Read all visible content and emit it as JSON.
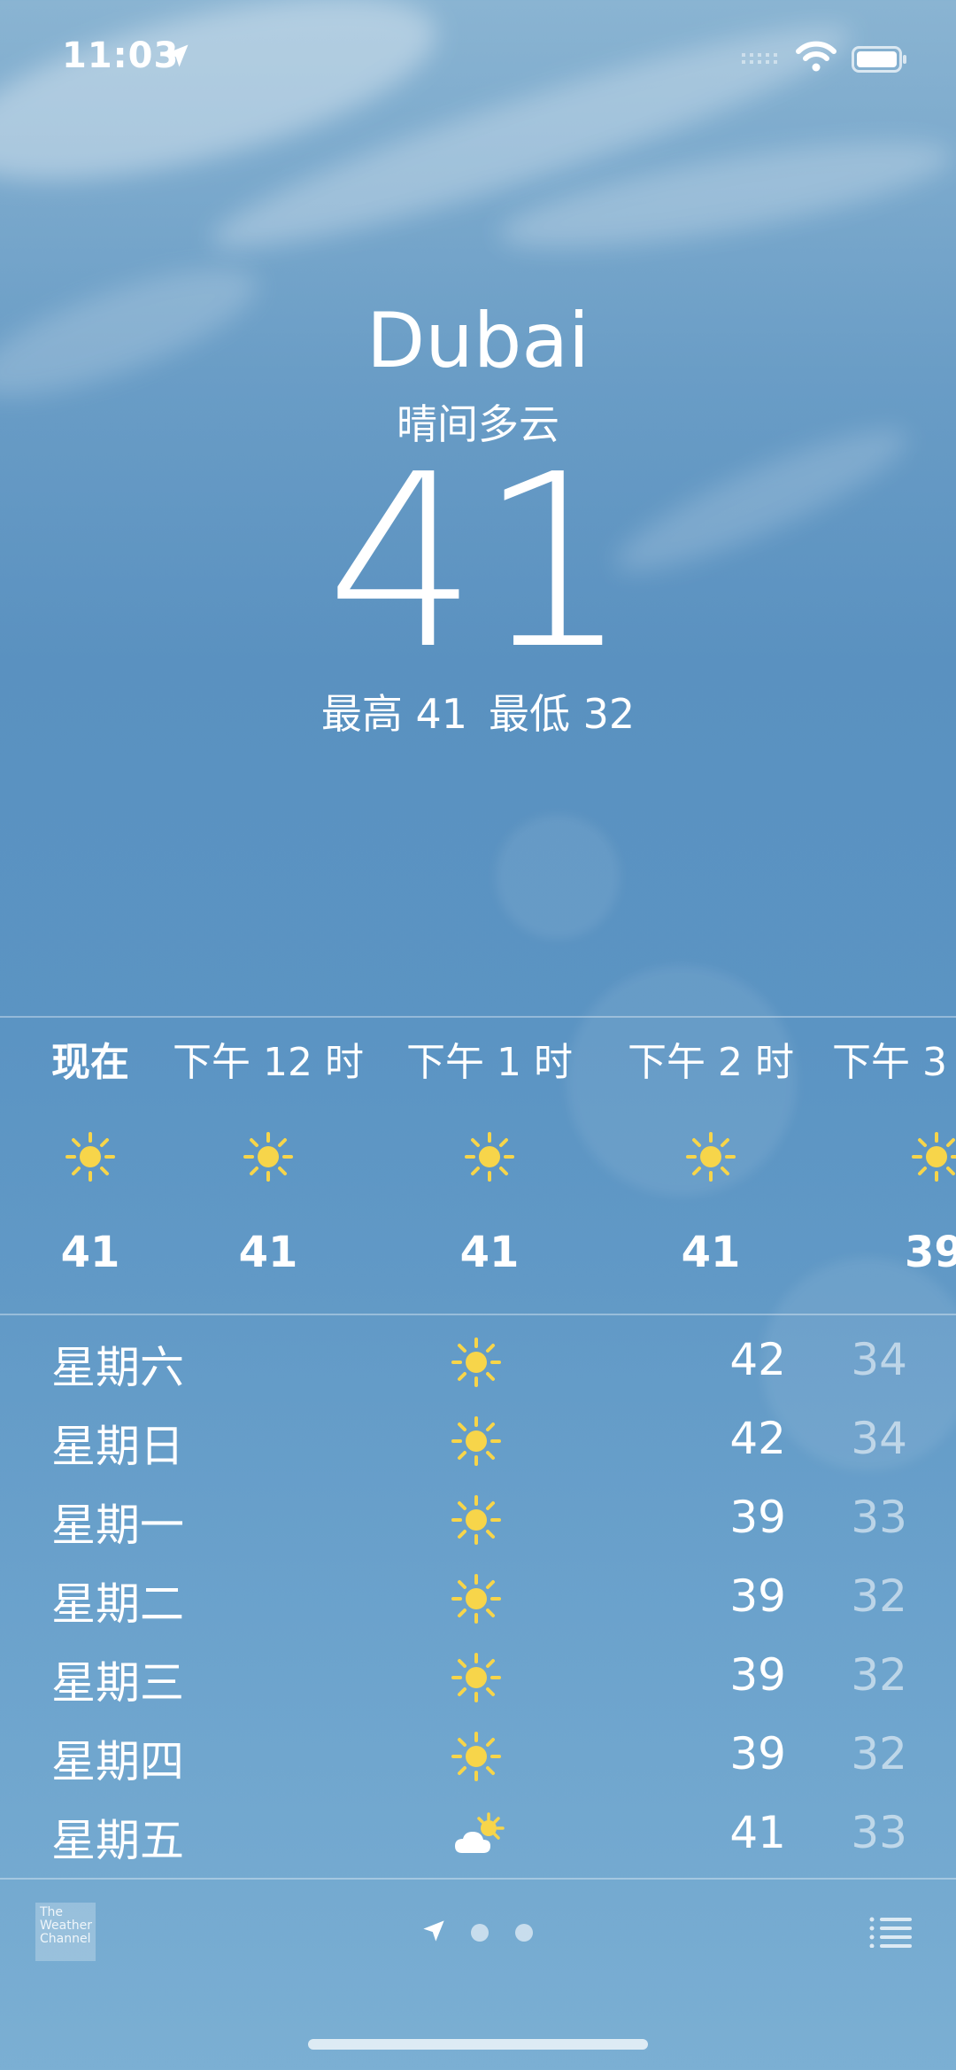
{
  "status_bar": {
    "time": "11:03"
  },
  "header": {
    "city": "Dubai",
    "condition": "晴间多云",
    "temperature": "41",
    "high_label": "最高 41",
    "low_label": "最低 32"
  },
  "hourly": [
    {
      "label": "现在",
      "icon": "sun-icon",
      "temp": "41"
    },
    {
      "label": "下午 12 时",
      "icon": "sun-icon",
      "temp": "41"
    },
    {
      "label": "下午 1 时",
      "icon": "sun-icon",
      "temp": "41"
    },
    {
      "label": "下午 2 时",
      "icon": "sun-icon",
      "temp": "41"
    },
    {
      "label": "下午 3",
      "icon": "sun-icon",
      "temp": "39"
    }
  ],
  "daily": [
    {
      "day": "星期六",
      "icon": "sun-icon",
      "high": "42",
      "low": "34"
    },
    {
      "day": "星期日",
      "icon": "sun-icon",
      "high": "42",
      "low": "34"
    },
    {
      "day": "星期一",
      "icon": "sun-icon",
      "high": "39",
      "low": "33"
    },
    {
      "day": "星期二",
      "icon": "sun-icon",
      "high": "39",
      "low": "32"
    },
    {
      "day": "星期三",
      "icon": "sun-icon",
      "high": "39",
      "low": "32"
    },
    {
      "day": "星期四",
      "icon": "sun-icon",
      "high": "39",
      "low": "32"
    },
    {
      "day": "星期五",
      "icon": "partly-cloudy-icon",
      "high": "41",
      "low": "33"
    }
  ],
  "footer": {
    "logo_text": "The Weather Channel",
    "pages": 3,
    "current_page": 1
  },
  "colors": {
    "sun": "#f7d54a",
    "background_top": "#8ab4d2",
    "background_bottom": "#7bafd3"
  }
}
